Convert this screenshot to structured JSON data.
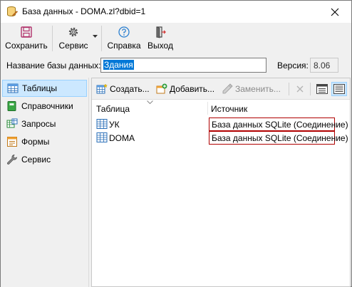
{
  "window": {
    "title": "База данных - DOMA.zl?dbid=1"
  },
  "toolbar": {
    "save": "Сохранить",
    "service": "Сервис",
    "help": "Справка",
    "exit": "Выход"
  },
  "db": {
    "name_label": "Название базы данных:",
    "name_value": "Здания",
    "version_label": "Версия:",
    "version_value": "8.06"
  },
  "sidebar": {
    "items": [
      {
        "label": "Таблицы",
        "icon": "table-icon",
        "active": true
      },
      {
        "label": "Справочники",
        "icon": "book-icon"
      },
      {
        "label": "Запросы",
        "icon": "query-icon"
      },
      {
        "label": "Формы",
        "icon": "form-icon"
      },
      {
        "label": "Сервис",
        "icon": "wrench-icon"
      }
    ]
  },
  "panel_toolbar": {
    "create": "Создать...",
    "add": "Добавить...",
    "replace": "Заменить..."
  },
  "table": {
    "columns": [
      "Таблица",
      "Источник"
    ],
    "rows": [
      {
        "name": "УК",
        "source": "База данных SQLite (Соединение)"
      },
      {
        "name": "DOMA",
        "source": "База данных SQLite (Соединение)"
      }
    ]
  },
  "colors": {
    "accent": "#0078d7",
    "selection": "#cce8ff",
    "source_border": "#b00000"
  }
}
